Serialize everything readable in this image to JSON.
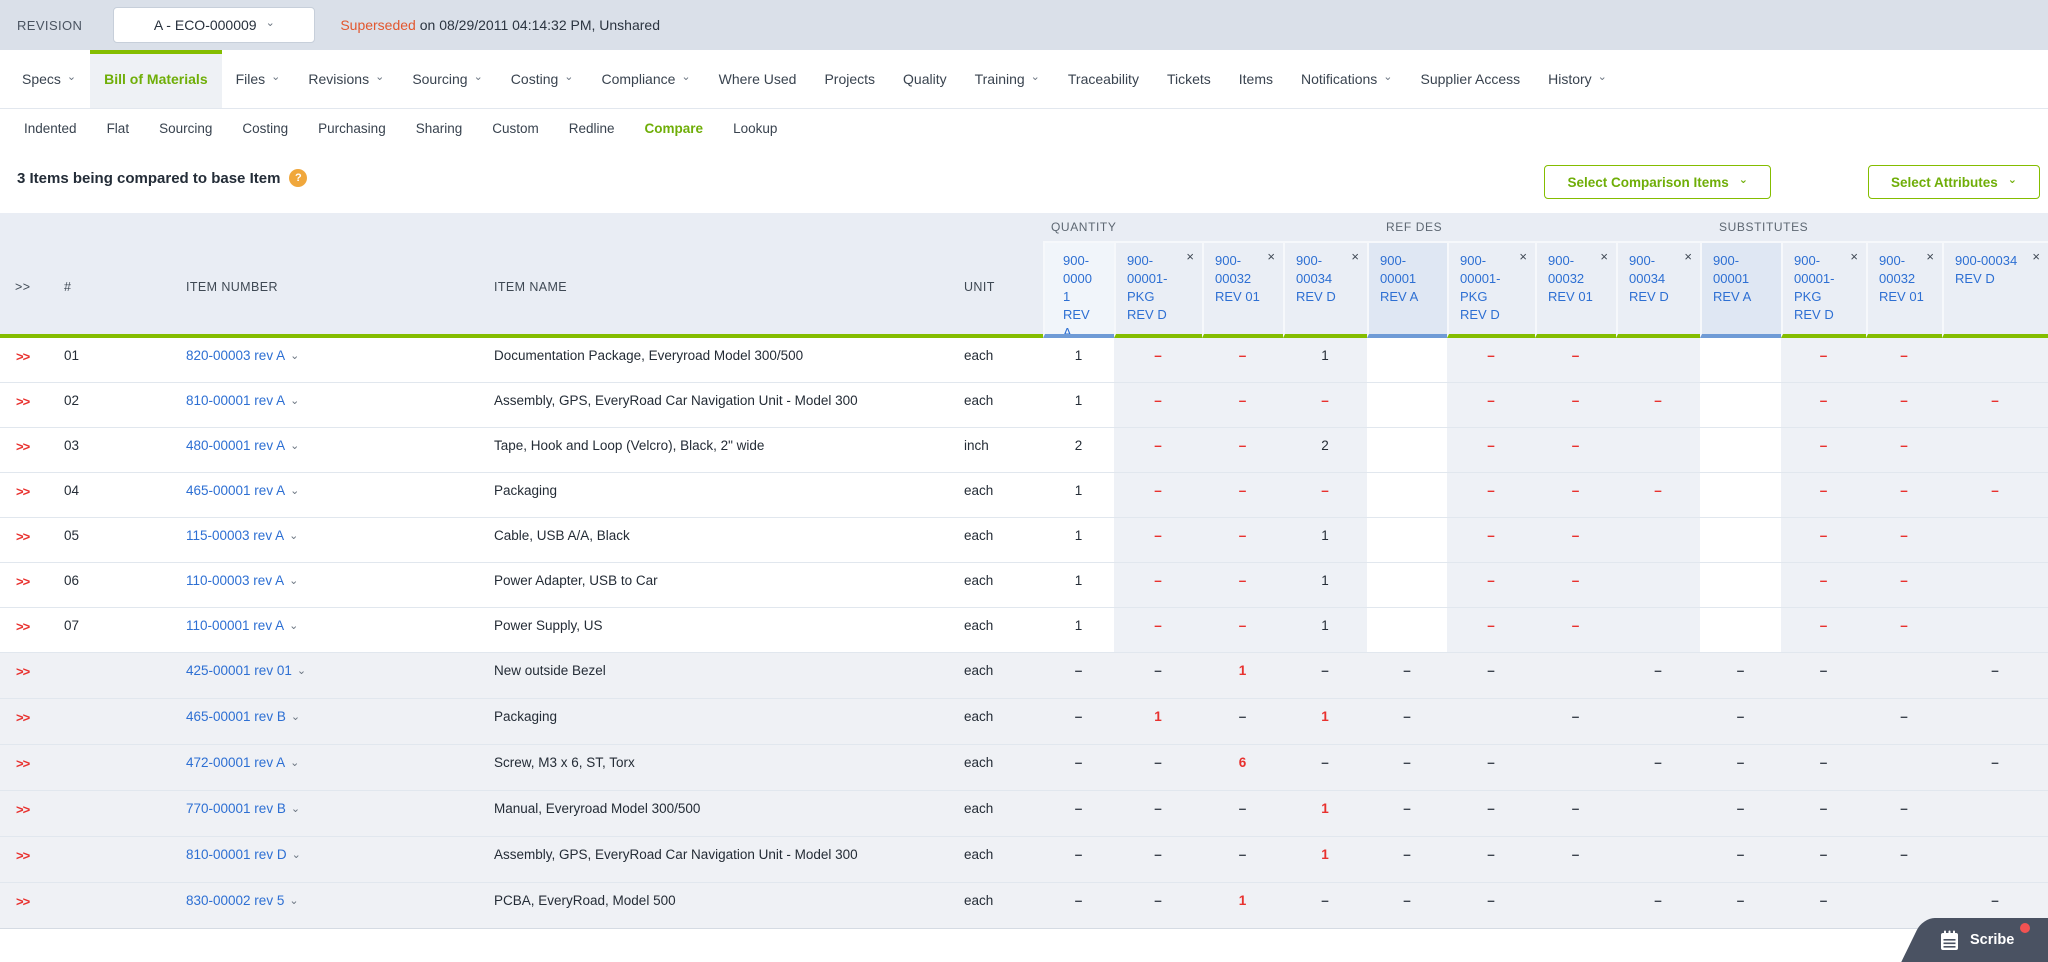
{
  "colors": {
    "green-line": "#84bd00",
    "green-text": "#6fae08",
    "blue-link": "#2d6fd3",
    "base-blue": "#6f9bd6",
    "red": "#e8312e",
    "orange": "#e2572f",
    "help-bg": "#f0a73c",
    "topbar-bg": "#dae0e9",
    "hdr-bg": "#e9edf4",
    "band": "#eef1f6",
    "added-bg": "#eff1f5",
    "row-border": "#e1e7ee"
  },
  "revision_bar": {
    "label": "REVISION",
    "dropdown_value": "A - ECO-000009",
    "status": "Superseded",
    "status_suffix": "on 08/29/2011 04:14:32 PM, Unshared"
  },
  "nav_tabs": [
    {
      "label": "Specs",
      "caret": true,
      "active": false
    },
    {
      "label": "Bill of Materials",
      "caret": false,
      "active": true
    },
    {
      "label": "Files",
      "caret": true,
      "active": false
    },
    {
      "label": "Revisions",
      "caret": true,
      "active": false
    },
    {
      "label": "Sourcing",
      "caret": true,
      "active": false
    },
    {
      "label": "Costing",
      "caret": true,
      "active": false
    },
    {
      "label": "Compliance",
      "caret": true,
      "active": false
    },
    {
      "label": "Where Used",
      "caret": false,
      "active": false
    },
    {
      "label": "Projects",
      "caret": false,
      "active": false
    },
    {
      "label": "Quality",
      "caret": false,
      "active": false
    },
    {
      "label": "Training",
      "caret": true,
      "active": false
    },
    {
      "label": "Traceability",
      "caret": false,
      "active": false
    },
    {
      "label": "Tickets",
      "caret": false,
      "active": false
    },
    {
      "label": "Items",
      "caret": false,
      "active": false
    },
    {
      "label": "Notifications",
      "caret": true,
      "active": false
    },
    {
      "label": "Supplier Access",
      "caret": false,
      "active": false
    },
    {
      "label": "History",
      "caret": true,
      "active": false
    }
  ],
  "sub_tabs": [
    {
      "label": "Indented",
      "active": false
    },
    {
      "label": "Flat",
      "active": false
    },
    {
      "label": "Sourcing",
      "active": false
    },
    {
      "label": "Costing",
      "active": false
    },
    {
      "label": "Purchasing",
      "active": false
    },
    {
      "label": "Sharing",
      "active": false
    },
    {
      "label": "Custom",
      "active": false
    },
    {
      "label": "Redline",
      "active": false
    },
    {
      "label": "Compare",
      "active": true
    },
    {
      "label": "Lookup",
      "active": false
    }
  ],
  "toolbar": {
    "heading": "3 Items being compared to base Item",
    "help_icon": "?",
    "select_comparison_items_label": "Select Comparison Items",
    "select_attributes_label": "Select Attributes"
  },
  "table": {
    "headers": {
      "chevrons": ">>",
      "num": "#",
      "item_number": "ITEM NUMBER",
      "item_name": "ITEM NAME",
      "unit": "UNIT"
    },
    "groups": [
      {
        "label": "QUANTITY"
      },
      {
        "label": "REF DES"
      },
      {
        "label": "SUBSTITUTES"
      }
    ],
    "compare_items": [
      {
        "label": "900-00001 REV A",
        "base": true
      },
      {
        "label": "900-00001-PKG REV D",
        "base": false
      },
      {
        "label": "900-00032 REV 01",
        "base": false
      },
      {
        "label": "900-00034 REV D",
        "base": false
      }
    ],
    "remove_icon": "×",
    "rows": [
      {
        "section": "common",
        "num": "01",
        "item_number": "820-00003 rev A",
        "item_name": "Documentation Package, Everyroad Model 300/500",
        "unit": "each",
        "cells": [
          "1",
          "—r",
          "—r",
          "1",
          "",
          "—r",
          "—r",
          "",
          "",
          "—r",
          "—r",
          ""
        ]
      },
      {
        "section": "common",
        "num": "02",
        "item_number": "810-00001 rev A",
        "item_name": "Assembly, GPS, EveryRoad Car Navigation Unit - Model 300",
        "unit": "each",
        "cells": [
          "1",
          "—r",
          "—r",
          "—r",
          "",
          "—r",
          "—r",
          "—r",
          "",
          "—r",
          "—r",
          "—r"
        ]
      },
      {
        "section": "common",
        "num": "03",
        "item_number": "480-00001 rev A",
        "item_name": "Tape, Hook and Loop (Velcro), Black, 2\" wide",
        "unit": "inch",
        "cells": [
          "2",
          "—r",
          "—r",
          "2",
          "",
          "—r",
          "—r",
          "",
          "",
          "—r",
          "—r",
          ""
        ]
      },
      {
        "section": "common",
        "num": "04",
        "item_number": "465-00001 rev A",
        "item_name": "Packaging",
        "unit": "each",
        "cells": [
          "1",
          "—r",
          "—r",
          "—r",
          "",
          "—r",
          "—r",
          "—r",
          "",
          "—r",
          "—r",
          "—r"
        ]
      },
      {
        "section": "common",
        "num": "05",
        "item_number": "115-00003 rev A",
        "item_name": "Cable, USB A/A, Black",
        "unit": "each",
        "cells": [
          "1",
          "—r",
          "—r",
          "1",
          "",
          "—r",
          "—r",
          "",
          "",
          "—r",
          "—r",
          ""
        ]
      },
      {
        "section": "common",
        "num": "06",
        "item_number": "110-00003 rev A",
        "item_name": "Power Adapter, USB to Car",
        "unit": "each",
        "cells": [
          "1",
          "—r",
          "—r",
          "1",
          "",
          "—r",
          "—r",
          "",
          "",
          "—r",
          "—r",
          ""
        ]
      },
      {
        "section": "common",
        "num": "07",
        "item_number": "110-00001 rev A",
        "item_name": "Power Supply, US",
        "unit": "each",
        "cells": [
          "1",
          "—r",
          "—r",
          "1",
          "",
          "—r",
          "—r",
          "",
          "",
          "—r",
          "—r",
          ""
        ]
      },
      {
        "section": "added",
        "num": "",
        "item_number": "425-00001 rev 01",
        "item_name": "New outside Bezel",
        "unit": "each",
        "cells": [
          "—",
          "—",
          "1r",
          "—",
          "—",
          "—",
          "",
          "—",
          "—",
          "—",
          "",
          "—"
        ]
      },
      {
        "section": "added",
        "num": "",
        "item_number": "465-00001 rev B",
        "item_name": "Packaging",
        "unit": "each",
        "cells": [
          "—",
          "1r",
          "—",
          "1r",
          "—",
          "",
          "—",
          "",
          "—",
          "",
          "—",
          ""
        ]
      },
      {
        "section": "added",
        "num": "",
        "item_number": "472-00001 rev A",
        "item_name": "Screw, M3 x 6, ST, Torx",
        "unit": "each",
        "cells": [
          "—",
          "—",
          "6r",
          "—",
          "—",
          "—",
          "",
          "—",
          "—",
          "—",
          "",
          "—"
        ]
      },
      {
        "section": "added",
        "num": "",
        "item_number": "770-00001 rev B",
        "item_name": "Manual, Everyroad Model 300/500",
        "unit": "each",
        "cells": [
          "—",
          "—",
          "—",
          "1r",
          "—",
          "—",
          "—",
          "",
          "—",
          "—",
          "—",
          ""
        ]
      },
      {
        "section": "added",
        "num": "",
        "item_number": "810-00001 rev D",
        "item_name": "Assembly, GPS, EveryRoad Car Navigation Unit - Model 300",
        "unit": "each",
        "cells": [
          "—",
          "—",
          "—",
          "1r",
          "—",
          "—",
          "—",
          "",
          "—",
          "—",
          "—",
          ""
        ]
      },
      {
        "section": "added",
        "num": "",
        "item_number": "830-00002 rev 5",
        "item_name": "PCBA, EveryRoad, Model 500",
        "unit": "each",
        "cells": [
          "—",
          "—",
          "1r",
          "—",
          "—",
          "—",
          "",
          "—",
          "—",
          "—",
          "",
          "—"
        ]
      }
    ]
  },
  "scribe": {
    "label": "Scribe"
  }
}
